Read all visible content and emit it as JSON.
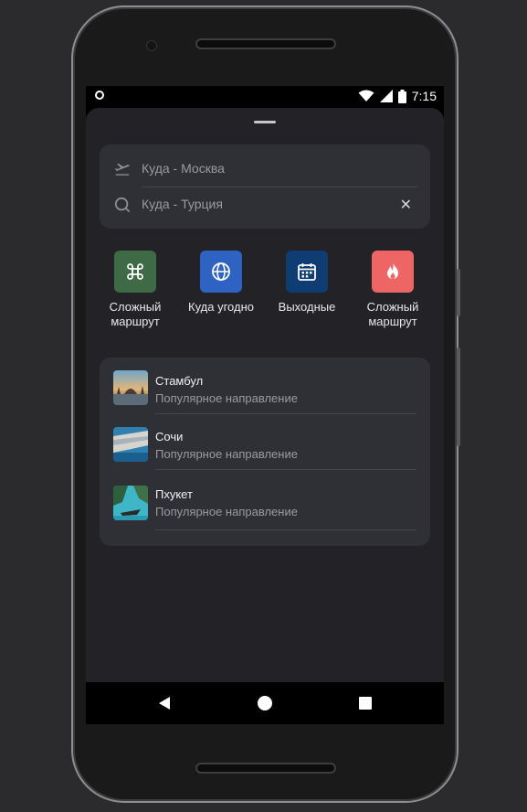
{
  "status_bar": {
    "time": "7:15"
  },
  "search": {
    "from_text": "Куда - Москва",
    "to_text": "Куда - Турция",
    "clear_glyph": "✕"
  },
  "quick_actions": [
    {
      "label_line1": "Сложный",
      "label_line2": "маршрут",
      "icon": "command-icon",
      "color": "#3e6b46"
    },
    {
      "label_line1": "Куда угодно",
      "label_line2": "",
      "icon": "globe-icon",
      "color": "#2e63c4"
    },
    {
      "label_line1": "Выходные",
      "label_line2": "",
      "icon": "calendar-icon",
      "color": "#0f3d73"
    },
    {
      "label_line1": "Сложный",
      "label_line2": "маршрут",
      "icon": "flame-icon",
      "color": "#ee6565"
    }
  ],
  "destinations": [
    {
      "name": "Стамбул",
      "subtitle": "Популярное направление",
      "icon": "istanbul-thumbnail"
    },
    {
      "name": "Сочи",
      "subtitle": "Популярное направление",
      "icon": "sochi-thumbnail"
    },
    {
      "name": "Пхукет",
      "subtitle": "Популярное направление",
      "icon": "phuket-thumbnail"
    }
  ]
}
